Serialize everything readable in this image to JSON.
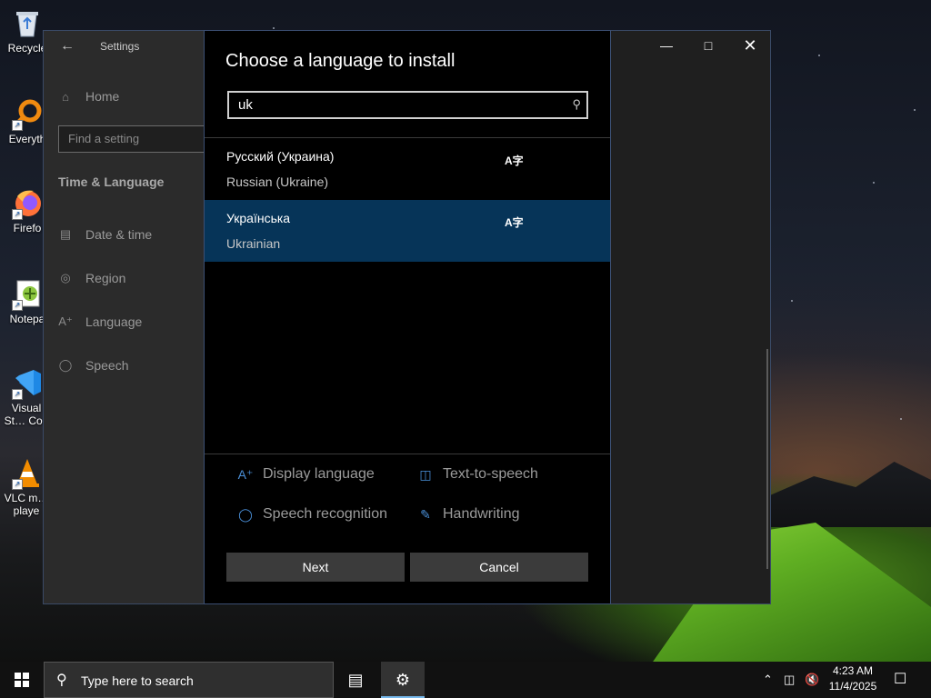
{
  "desktop": {
    "icons": [
      {
        "label": "Recycle"
      },
      {
        "label": "Everyth"
      },
      {
        "label": "Firefo"
      },
      {
        "label": "Notepa"
      },
      {
        "label": "Visual St… Cod"
      },
      {
        "label": "VLC m… playe"
      }
    ]
  },
  "settings": {
    "title": "Settings",
    "back_icon": "back-arrow-icon",
    "home_label": "Home",
    "find_placeholder": "Find a setting",
    "section_title": "Time & Language",
    "nav_items": [
      {
        "label": "Date & time",
        "icon": "calendar-clock-icon"
      },
      {
        "label": "Region",
        "icon": "globe-icon"
      },
      {
        "label": "Language",
        "icon": "language-icon"
      },
      {
        "label": "Speech",
        "icon": "microphone-icon"
      }
    ]
  },
  "dialog": {
    "title": "Choose a language to install",
    "search_value": "uk",
    "languages": [
      {
        "native": "Русский (Украина)",
        "english": "Russian (Ukraine)",
        "selected": false
      },
      {
        "native": "Українська",
        "english": "Ukrainian",
        "selected": true
      }
    ],
    "features": [
      {
        "label": "Display language",
        "icon": "display-language-icon"
      },
      {
        "label": "Text-to-speech",
        "icon": "text-to-speech-icon"
      },
      {
        "label": "Speech recognition",
        "icon": "microphone-icon"
      },
      {
        "label": "Handwriting",
        "icon": "handwriting-icon"
      }
    ],
    "next_label": "Next",
    "cancel_label": "Cancel",
    "selected_color": "#063458"
  },
  "taskbar": {
    "search_placeholder": "Type here to search",
    "time": "4:23 AM",
    "date": "11/4/2025"
  }
}
